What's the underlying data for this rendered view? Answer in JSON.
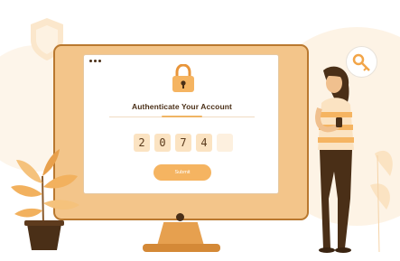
{
  "screen": {
    "title": "Authenticate Your Account",
    "code_digits": [
      "2",
      "0",
      "7",
      "4",
      ""
    ],
    "submit_label": "Submit"
  },
  "colors": {
    "accent": "#f5b461",
    "frame": "#f3c58a",
    "dark": "#4a2f17",
    "code_box": "#fbe3c2"
  },
  "icons": [
    "lock-icon",
    "key-icon",
    "shield-icon",
    "plant-illustration",
    "woman-with-phone-illustration"
  ]
}
